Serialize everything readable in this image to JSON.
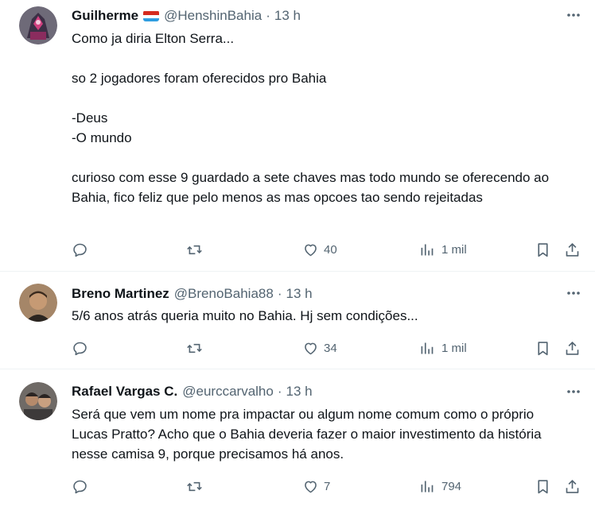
{
  "tweets": [
    {
      "name": "Guilherme",
      "has_flag": true,
      "handle": "@HenshinBahia",
      "separator": "·",
      "time": "13 h",
      "paragraphs": [
        "Como ja diria Elton Serra...",
        "so 2 jogadores foram oferecidos pro Bahia",
        "-Deus\n-O mundo",
        "curioso com esse 9 guardado a sete chaves mas todo mundo se oferecendo ao Bahia, fico feliz que pelo menos as mas opcoes tao sendo rejeitadas"
      ],
      "likes": "40",
      "views": "1 mil",
      "avatar_colors": [
        "#5a4f6a",
        "#c23a7a"
      ]
    },
    {
      "name": "Breno Martinez",
      "has_flag": false,
      "handle": "@BrenoBahia88",
      "separator": "·",
      "time": "13 h",
      "paragraphs": [
        "5/6 anos atrás queria muito no Bahia. Hj sem condições..."
      ],
      "likes": "34",
      "views": "1 mil",
      "avatar_colors": [
        "#6b5138",
        "#c9a27f"
      ]
    },
    {
      "name": "Rafael Vargas C.",
      "has_flag": false,
      "handle": "@eurccarvalho",
      "separator": "·",
      "time": "13 h",
      "paragraphs": [
        "Será que vem um nome pra impactar ou algum nome comum como o próprio Lucas Pratto? Acho que o Bahia deveria fazer o maior investimento da história nesse camisa 9, porque precisamos há anos."
      ],
      "likes": "7",
      "views": "794",
      "avatar_colors": [
        "#3d3a3a",
        "#b58a6b"
      ]
    }
  ],
  "colors": {
    "text": "#0f1419",
    "secondary": "#536471",
    "divider": "#eff3f4",
    "flag_red": "#d52b1e",
    "flag_blue": "#2f9de0"
  },
  "icons": [
    "reply-icon",
    "retweet-icon",
    "like-icon",
    "views-icon",
    "bookmark-icon",
    "share-icon",
    "more-icon"
  ]
}
